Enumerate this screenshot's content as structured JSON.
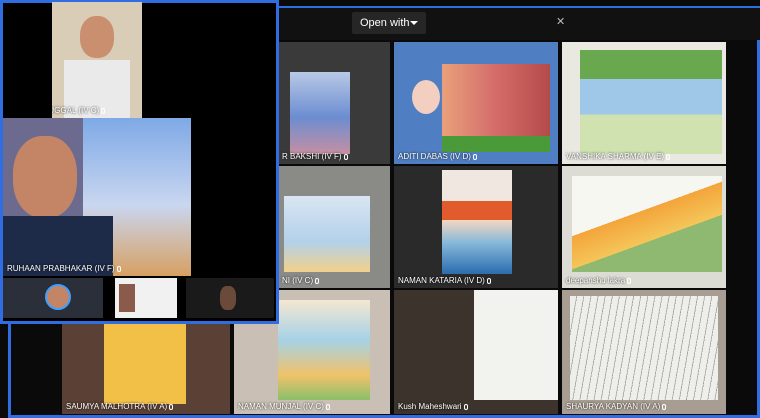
{
  "toolbar": {
    "open_with_label": "Open with",
    "close_glyph": "✕"
  },
  "participants": [
    {
      "name": "GAVISHT DUGGAL (IV C)"
    },
    {
      "name": "RUHAAN PRABHAKAR (IV F)"
    },
    {
      "name": "R BAKSHI (IV F)"
    },
    {
      "name": "ADITI DABAS (IV D)"
    },
    {
      "name": "VANSHIKA SHARMA (IV E)"
    },
    {
      "name": "NI (IV C)"
    },
    {
      "name": "NAMAN KATARIA (IV D)"
    },
    {
      "name": "deepanshu lakra"
    },
    {
      "name": "SAUMYA MALHOTRA (IV A)"
    },
    {
      "name": "NAMAN MUNJAL (IV C)"
    },
    {
      "name": "Kush Maheshwari"
    },
    {
      "name": "SHAURYA KADYAN (IV A)"
    }
  ],
  "colors": {
    "frame": "#2f6de0"
  }
}
